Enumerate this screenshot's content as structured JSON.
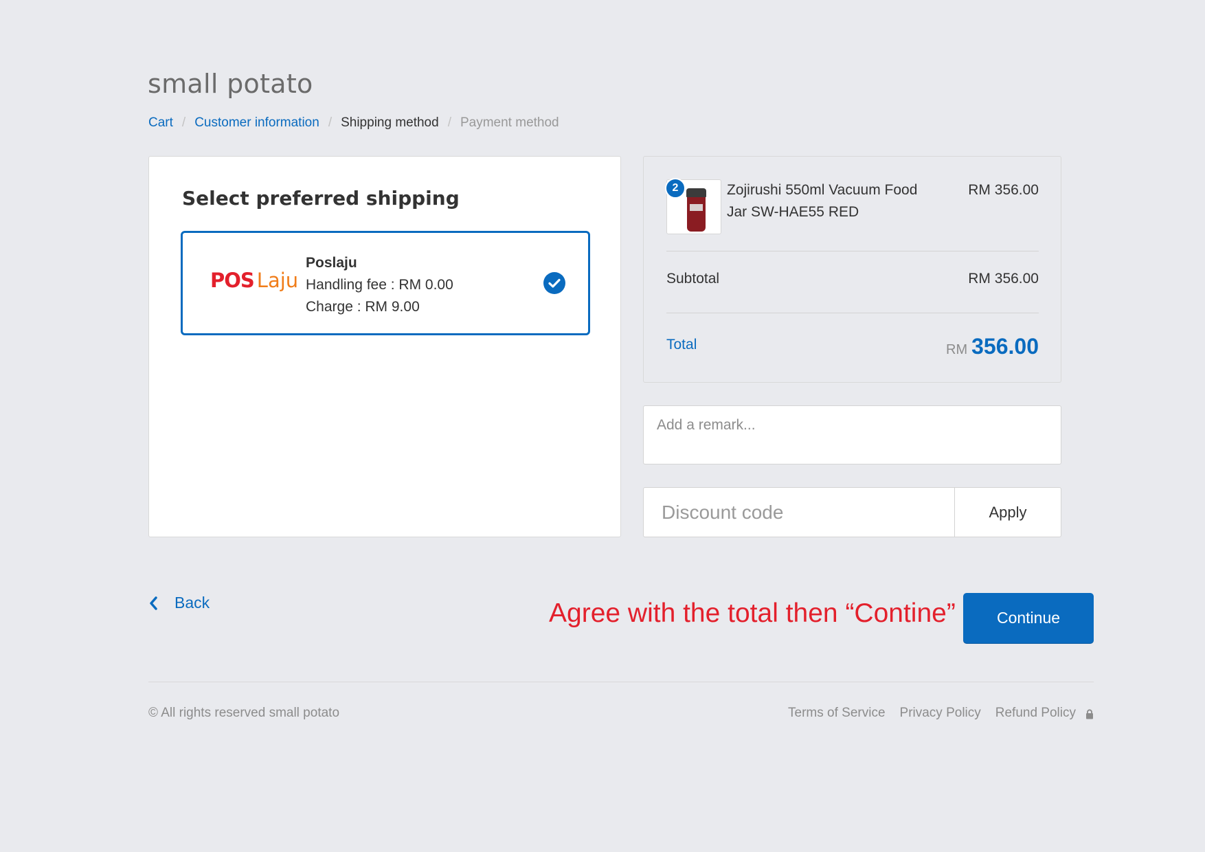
{
  "shop": {
    "title": "small potato"
  },
  "breadcrumb": {
    "items": [
      {
        "label": "Cart"
      },
      {
        "label": "Customer information"
      },
      {
        "label": "Shipping method"
      },
      {
        "label": "Payment method"
      }
    ],
    "separator": "/"
  },
  "shipping": {
    "heading": "Select preferred shipping",
    "option": {
      "logo_text_pos": "POS",
      "logo_text_laju": "Laju",
      "name": "Poslaju",
      "handling_fee": "Handling fee : RM 0.00",
      "charge": "Charge : RM 9.00",
      "selected": true,
      "icon": "check-circle-icon"
    }
  },
  "summary": {
    "product": {
      "quantity": "2",
      "name": "Zojirushi 550ml Vacuum Food Jar SW-HAE55 RED",
      "price": "RM 356.00"
    },
    "subtotal_label": "Subtotal",
    "subtotal_value": "RM 356.00",
    "total_label": "Total",
    "total_currency": "RM",
    "total_amount": "356.00"
  },
  "remark": {
    "placeholder": "Add a remark..."
  },
  "discount": {
    "placeholder": "Discount code",
    "apply_label": "Apply"
  },
  "actions": {
    "back_label": "Back",
    "back_icon": "chevron-left-icon",
    "continue_label": "Continue"
  },
  "annotation": {
    "text": "Agree with the total then “Contine”"
  },
  "footer": {
    "copyright": "© All rights reserved small potato",
    "links": [
      "Terms of Service",
      "Privacy Policy",
      "Refund Policy"
    ],
    "lock_icon": "lock-icon"
  },
  "colors": {
    "accent": "#0a6bbf",
    "annotation": "#e3202c",
    "background": "#e9eaee",
    "logo_red": "#e3202c",
    "logo_orange": "#f07d1a"
  }
}
